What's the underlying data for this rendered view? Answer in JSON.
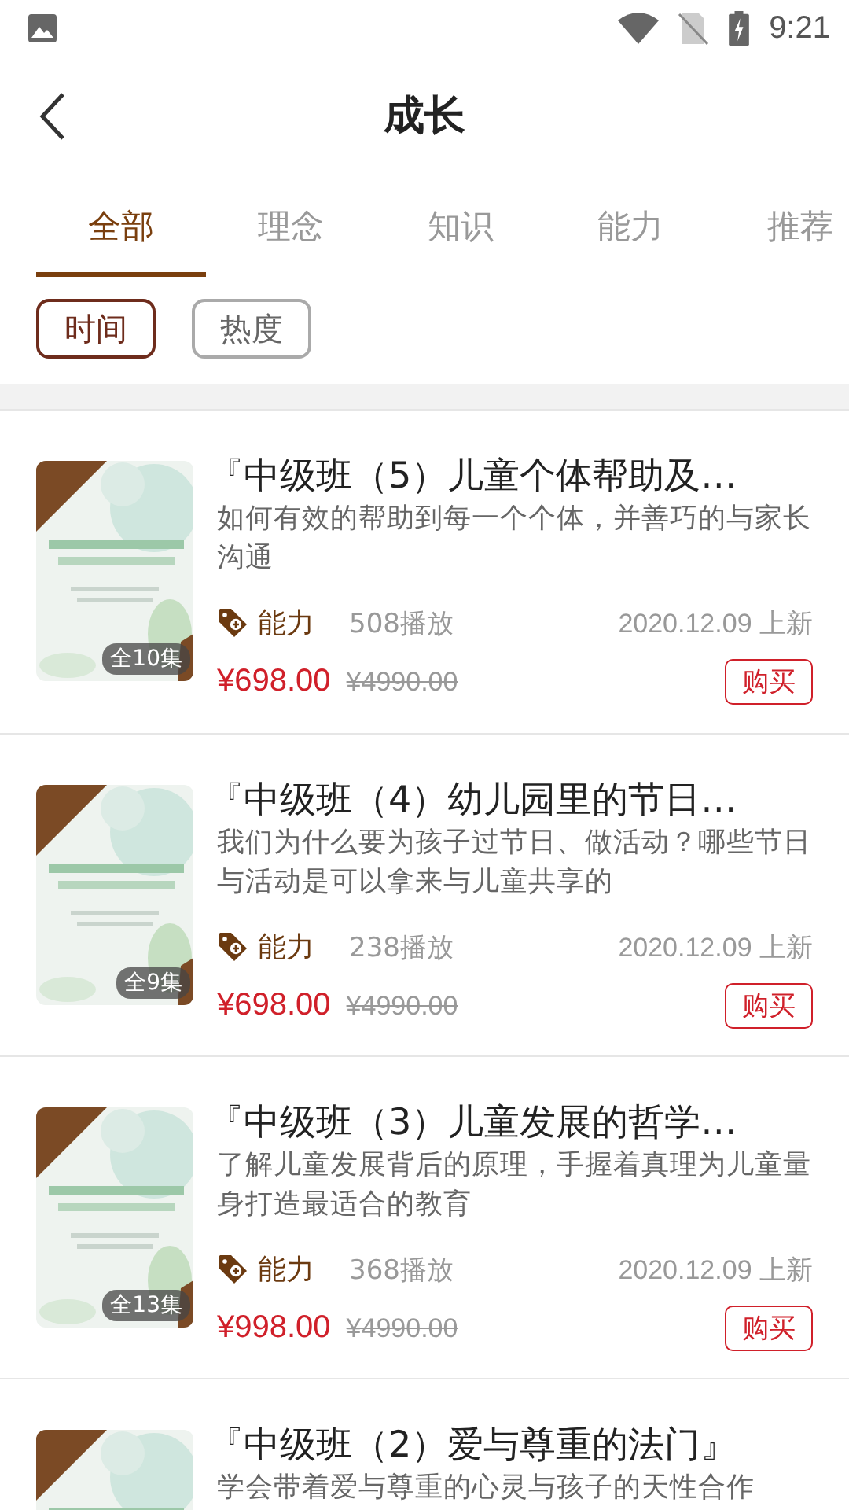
{
  "status_bar": {
    "time": "9:21"
  },
  "header": {
    "title": "成长"
  },
  "tabs": [
    {
      "label": "全部",
      "selected": true
    },
    {
      "label": "理念",
      "selected": false
    },
    {
      "label": "知识",
      "selected": false
    },
    {
      "label": "能力",
      "selected": false
    },
    {
      "label": "推荐",
      "selected": false
    }
  ],
  "sort_chips": [
    {
      "label": "时间",
      "selected": true
    },
    {
      "label": "热度",
      "selected": false
    }
  ],
  "courses": [
    {
      "title": "『中级班（5）儿童个体帮助及…",
      "description": "如何有效的帮助到每一个个体，并善巧的与家长沟通",
      "episodes": "全10集",
      "tag": "能力",
      "plays": "508播放",
      "date": "2020.12.09 上新",
      "price": "¥698.00",
      "original_price": "¥4990.00",
      "buy": "购买"
    },
    {
      "title": "『中级班（4）幼儿园里的节日…",
      "description": "我们为什么要为孩子过节日、做活动？哪些节日与活动是可以拿来与儿童共享的",
      "episodes": "全9集",
      "tag": "能力",
      "plays": "238播放",
      "date": "2020.12.09 上新",
      "price": "¥698.00",
      "original_price": "¥4990.00",
      "buy": "购买"
    },
    {
      "title": "『中级班（3）儿童发展的哲学…",
      "description": "了解儿童发展背后的原理，手握着真理为儿童量身打造最适合的教育",
      "episodes": "全13集",
      "tag": "能力",
      "plays": "368播放",
      "date": "2020.12.09 上新",
      "price": "¥998.00",
      "original_price": "¥4990.00",
      "buy": "购买"
    },
    {
      "title": "『中级班（2）爱与尊重的法门』",
      "description": "学会带着爱与尊重的心灵与孩子的天性合作"
    }
  ]
}
